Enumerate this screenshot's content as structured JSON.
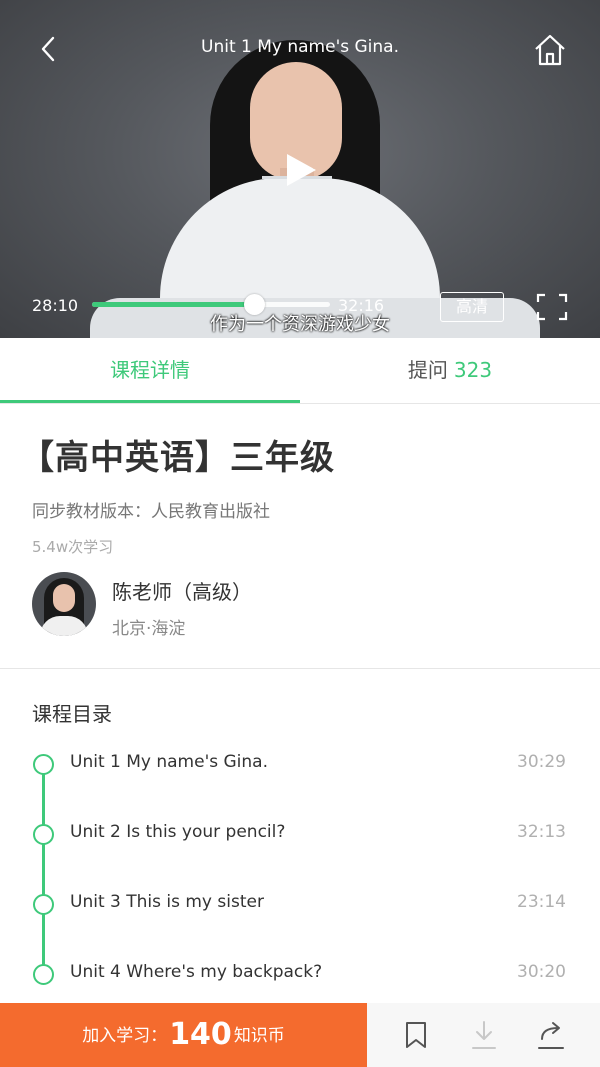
{
  "video": {
    "title": "Unit 1 My name's Gina.",
    "current_time": "28:10",
    "total_time": "32:16",
    "progress": 0.68,
    "subtitle": "作为一个资深游戏少女",
    "quality_label": "高清"
  },
  "tabs": {
    "details_label": "课程详情",
    "questions_label": "提问",
    "questions_count": "323"
  },
  "course": {
    "title": "【高中英语】三年级",
    "publisher": "同步教材版本：人民教育出版社",
    "learners": "5.4w次学习"
  },
  "teacher": {
    "name": "陈老师（高级）",
    "location": "北京·海淀"
  },
  "catalog": {
    "title": "课程目录",
    "lessons": [
      {
        "title": "Unit 1 My name's Gina.",
        "duration": "30:29"
      },
      {
        "title": "Unit 2 Is this your pencil?",
        "duration": "32:13"
      },
      {
        "title": "Unit 3 This is my sister",
        "duration": "23:14"
      },
      {
        "title": "Unit 4 Where's my backpack?",
        "duration": "30:20"
      }
    ]
  },
  "bottom_bar": {
    "join_prefix": "加入学习：",
    "join_price": "140",
    "join_suffix": "知识币"
  },
  "colors": {
    "accent_green": "#3ec97a",
    "join_orange": "#f46b2e"
  },
  "icons": [
    "back-icon",
    "home-icon",
    "play-icon",
    "fullscreen-icon",
    "bookmark-icon",
    "download-icon",
    "share-icon"
  ]
}
